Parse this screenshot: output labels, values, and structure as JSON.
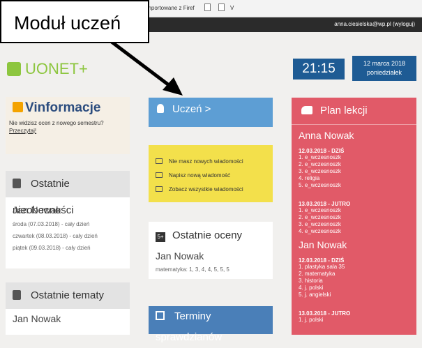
{
  "browser": {
    "bookmarks_text": "Importowane z Firef",
    "bookmark_extra": "V",
    "user_link": "anna.ciesielska@wp.pl (wyloguj)"
  },
  "callout": {
    "label": "Moduł uczeń"
  },
  "logo": {
    "text": "UONET+"
  },
  "clock": {
    "time": "21:15",
    "date_line1": "12 marca 2018",
    "date_line2": "poniedziałek"
  },
  "vinformacje": {
    "title": "Vinformacje",
    "text": "Nie widzisz ocen z nowego semestru?",
    "link": "Przeczytaj!"
  },
  "nieobecnosci": {
    "title": "Ostatnie nieobecności",
    "name": "Jan Nowak",
    "items": [
      "środa (07.03.2018) - cały dzień",
      "czwartek (08.03.2018) - cały dzień",
      "piątek (09.03.2018) - cały dzień"
    ]
  },
  "tematy": {
    "title": "Ostatnie tematy",
    "name": "Jan Nowak"
  },
  "uczen": {
    "label": "Uczeń >"
  },
  "messages": {
    "items": [
      "Nie masz nowych wiadomości",
      "Napisz nową wiadomość",
      "Zobacz wszystkie wiadomości"
    ]
  },
  "oceny": {
    "icon_text": "5+",
    "title": "Ostatnie oceny",
    "name": "Jan Nowak",
    "values": "matematyka: 1, 3, 4, 4, 5, 5, 5"
  },
  "terminy": {
    "title": "Terminy sprawdzianów"
  },
  "plan": {
    "title": "Plan lekcji",
    "student1": {
      "name": "Anna Nowak",
      "days": [
        {
          "head": "12.03.2018 - DZIŚ",
          "lessons": [
            "1. e_wczesnoszk",
            "2. e_wczesnoszk",
            "3. e_wczesnoszk",
            "4. religia",
            "5. e_wczesnoszk"
          ]
        },
        {
          "head": "13.03.2018 - JUTRO",
          "lessons": [
            "1. e_wczesnoszk",
            "2. e_wczesnoszk",
            "3. e_wczesnoszk",
            "4. e_wczesnoszk"
          ]
        }
      ]
    },
    "student2": {
      "name": "Jan Nowak",
      "days": [
        {
          "head": "12.03.2018 - DZIŚ",
          "lessons": [
            "1. plastyka sala 35",
            "2. matematyka",
            "3. historia",
            "4. j. polski",
            "5. j. angielski"
          ]
        },
        {
          "head": "13.03.2018 - JUTRO",
          "lessons": [
            "1. j. polski"
          ]
        }
      ]
    }
  }
}
